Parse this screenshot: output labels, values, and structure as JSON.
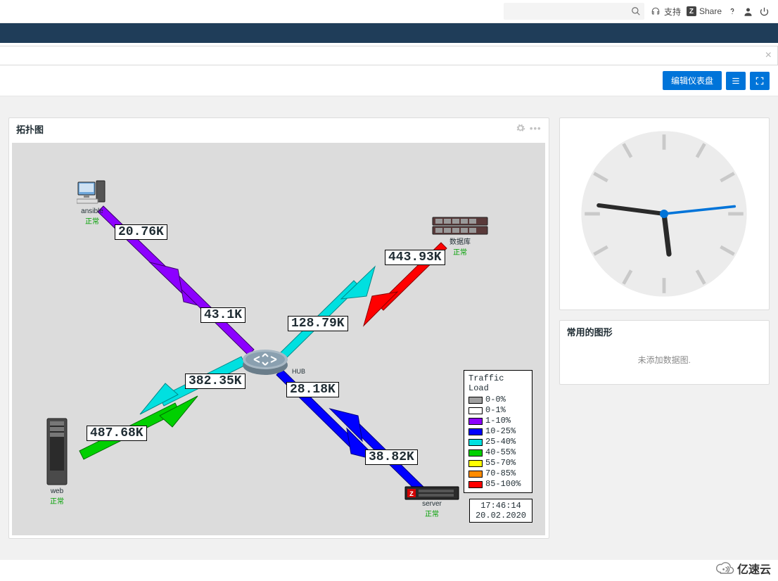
{
  "topbar": {
    "search_placeholder": "",
    "support_label": "支持",
    "share_label": "Share"
  },
  "actions": {
    "edit_dashboard": "编辑仪表盘"
  },
  "widgets": {
    "topology": {
      "title": "拓扑图",
      "hub_label": "HUB",
      "nodes": {
        "ansible": {
          "name": "ansible",
          "status": "正常"
        },
        "database": {
          "name": "数据库",
          "status": "正常"
        },
        "web": {
          "name": "web",
          "status": "正常"
        },
        "server": {
          "name": "server",
          "status": "正常"
        }
      },
      "traffic_values": {
        "ansible_out": "20.76K",
        "ansible_in": "43.1K",
        "database_out": "443.93K",
        "database_in": "128.79K",
        "web_out": "487.68K",
        "web_in": "382.35K",
        "server_out": "38.82K",
        "server_in": "28.18K"
      },
      "legend": {
        "title": "Traffic Load",
        "ranges": [
          {
            "label": "0-0%",
            "color": "#a0a0a0"
          },
          {
            "label": "0-1%",
            "color": "#ffffff"
          },
          {
            "label": "1-10%",
            "color": "#8c00ff"
          },
          {
            "label": "10-25%",
            "color": "#0000ff"
          },
          {
            "label": "25-40%",
            "color": "#00e0e0"
          },
          {
            "label": "40-55%",
            "color": "#00d000"
          },
          {
            "label": "55-70%",
            "color": "#ffff00"
          },
          {
            "label": "70-85%",
            "color": "#ff8c00"
          },
          {
            "label": "85-100%",
            "color": "#ff0000"
          }
        ]
      },
      "timestamp": {
        "time": "17:46:14",
        "date": "20.02.2020"
      }
    },
    "clock": {
      "hour": 17,
      "minute": 46,
      "second": 14
    },
    "graphs": {
      "title": "常用的图形",
      "empty_text": "未添加数据图."
    }
  },
  "chart_data": {
    "type": "network-topology",
    "nodes": [
      "HUB",
      "ansible",
      "数据库",
      "web",
      "server"
    ],
    "edges": [
      {
        "from": "ansible",
        "to": "HUB",
        "label": "20.76K",
        "load_band": "1-10%"
      },
      {
        "from": "HUB",
        "to": "ansible",
        "label": "43.1K",
        "load_band": "1-10%"
      },
      {
        "from": "数据库",
        "to": "HUB",
        "label": "443.93K",
        "load_band": "85-100%"
      },
      {
        "from": "HUB",
        "to": "数据库",
        "label": "128.79K",
        "load_band": "25-40%"
      },
      {
        "from": "web",
        "to": "HUB",
        "label": "487.68K",
        "load_band": "40-55%"
      },
      {
        "from": "HUB",
        "to": "web",
        "label": "382.35K",
        "load_band": "25-40%"
      },
      {
        "from": "server",
        "to": "HUB",
        "label": "38.82K",
        "load_band": "10-25%"
      },
      {
        "from": "HUB",
        "to": "server",
        "label": "28.18K",
        "load_band": "10-25%"
      }
    ],
    "legend_bands": [
      "0-0%",
      "0-1%",
      "1-10%",
      "10-25%",
      "25-40%",
      "40-55%",
      "55-70%",
      "70-85%",
      "85-100%"
    ],
    "timestamp": "20.02.2020 17:46:14"
  },
  "watermark": "亿速云"
}
